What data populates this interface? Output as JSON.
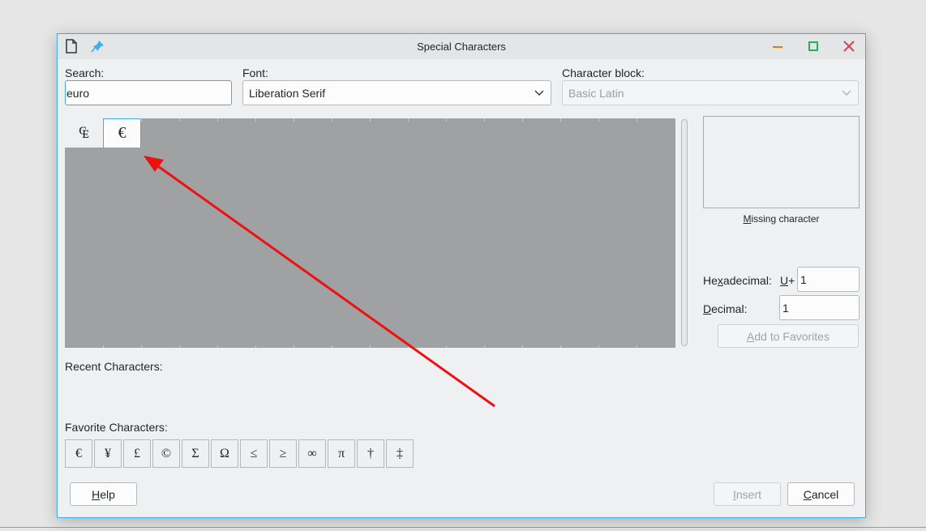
{
  "window": {
    "title": "Special Characters"
  },
  "search": {
    "label": "Search:",
    "value": "euro"
  },
  "font": {
    "label": "Font:",
    "value": "Liberation Serif"
  },
  "block": {
    "label": "Character block:",
    "value": "Basic Latin"
  },
  "results": [
    {
      "char": "₠",
      "selected": false
    },
    {
      "char": "€",
      "selected": true
    }
  ],
  "preview": {
    "caption_prefix": "M",
    "caption_rest": "issing character"
  },
  "code": {
    "hex_label_a": "He",
    "hex_label_u": "x",
    "hex_label_b": "adecimal:",
    "uplus_u": "U",
    "uplus_rest": "+",
    "hex_value": "1",
    "dec_label_u": "D",
    "dec_label_rest": "ecimal:",
    "dec_value": "1"
  },
  "buttons": {
    "add_fav_u": "A",
    "add_fav_rest": "dd to Favorites",
    "help_u": "H",
    "help_rest": "elp",
    "insert_u": "I",
    "insert_rest": "nsert",
    "cancel_u": "C",
    "cancel_rest": "ancel"
  },
  "recent": {
    "label": "Recent Characters:"
  },
  "favorites": {
    "label": "Favorite Characters:",
    "chars": [
      "€",
      "¥",
      "£",
      "©",
      "Σ",
      "Ω",
      "≤",
      "≥",
      "∞",
      "π",
      "†",
      "‡"
    ]
  },
  "colors": {
    "accent": "#3daee9",
    "annotation_arrow": "#ee1111",
    "minimize": "#f67400",
    "maximize": "#27ae60",
    "close": "#da4453"
  },
  "icons": {
    "app": "document-icon",
    "pin": "pin-icon",
    "minimize": "minimize-icon",
    "maximize": "maximize-icon",
    "close": "close-icon"
  }
}
